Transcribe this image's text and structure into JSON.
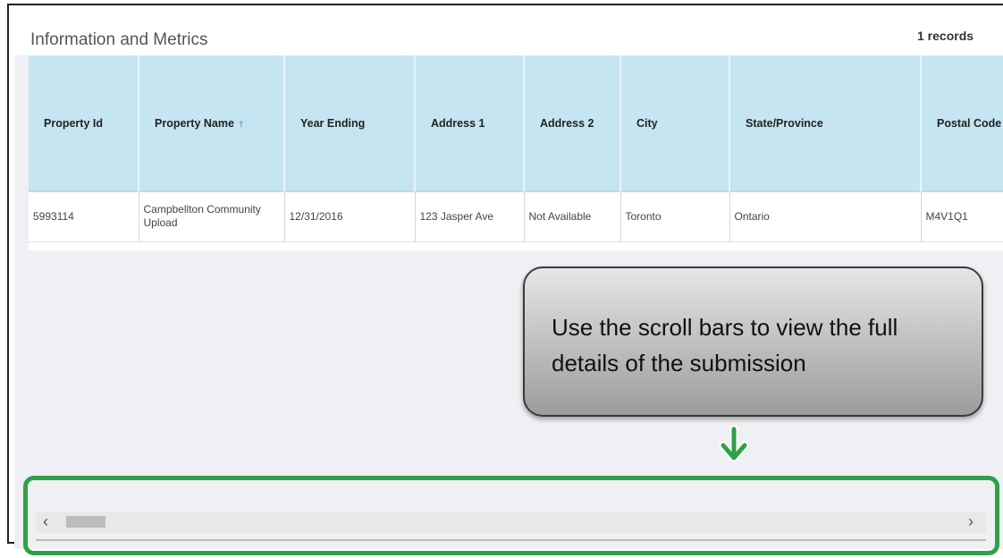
{
  "panel": {
    "title": "Information and Metrics",
    "records": "1 records"
  },
  "table": {
    "columns": [
      "Property Id",
      "Property Name",
      "Year Ending",
      "Address 1",
      "Address 2",
      "City",
      "State/Province",
      "Postal Code"
    ],
    "sort_indicator": "⇡",
    "rows": [
      [
        "5993114",
        "Campbellton Community Upload",
        "12/31/2016",
        "123 Jasper Ave",
        "Not Available",
        "Toronto",
        "Ontario",
        "M4V1Q1"
      ]
    ]
  },
  "callout": {
    "text": "Use the scroll bars to view the full details of the submission"
  },
  "scrollbar": {
    "left_arrow": "‹",
    "right_arrow": "›",
    "position": 0.0
  },
  "colors": {
    "header_bg": "#c5e6f1",
    "highlight": "#2fa04a",
    "panel_bg": "#eef0f3"
  },
  "icons": [
    "sort-ascending-icon",
    "arrow-down-icon",
    "chevron-left-icon",
    "chevron-right-icon"
  ]
}
